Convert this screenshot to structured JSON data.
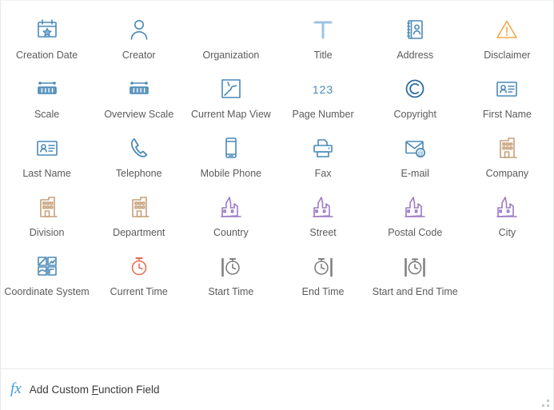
{
  "colors": {
    "icon_blue": "#4a89b8",
    "icon_blue_light": "#9dc3e0",
    "icon_orange": "#f0a848",
    "icon_tan": "#c6a079",
    "icon_purple": "#9b7bc4",
    "icon_red": "#e8705a",
    "icon_gray": "#808080",
    "caption": "#5b5b5b",
    "accent": "#3c9ce0",
    "panel_border": "#e6e8ea"
  },
  "gallery": {
    "columns": 6,
    "items": [
      {
        "label": "Creation Date",
        "icon": "calendar-star-icon",
        "color": "#4a89b8"
      },
      {
        "label": "Creator",
        "icon": "person-icon",
        "color": "#4a89b8"
      },
      {
        "label": "Organization",
        "icon": "none",
        "color": "#4a89b8"
      },
      {
        "label": "Title",
        "icon": "text-t-icon",
        "color": "#9dc3e0"
      },
      {
        "label": "Address",
        "icon": "address-book-icon",
        "color": "#4a89b8"
      },
      {
        "label": "Disclaimer",
        "icon": "warning-triangle-icon",
        "color": "#f0a848"
      },
      {
        "label": "Scale",
        "icon": "scale-bar-icon",
        "color": "#4a89b8"
      },
      {
        "label": "Overview Scale",
        "icon": "scale-bar-icon",
        "color": "#4a89b8"
      },
      {
        "label": "Current Map View",
        "icon": "map-frame-icon",
        "color": "#4a89b8"
      },
      {
        "label": "Page Number",
        "icon": "digits-123-icon",
        "color": "#4a89b8"
      },
      {
        "label": "Copyright",
        "icon": "copyright-icon",
        "color": "#2d6ca3"
      },
      {
        "label": "First Name",
        "icon": "contact-card-icon",
        "color": "#4a89b8"
      },
      {
        "label": "Last Name",
        "icon": "contact-card-icon",
        "color": "#4a89b8"
      },
      {
        "label": "Telephone",
        "icon": "telephone-icon",
        "color": "#4a89b8"
      },
      {
        "label": "Mobile Phone",
        "icon": "mobile-phone-icon",
        "color": "#4a89b8"
      },
      {
        "label": "Fax",
        "icon": "fax-printer-icon",
        "color": "#4a89b8"
      },
      {
        "label": "E-mail",
        "icon": "envelope-at-icon",
        "color": "#4a89b8"
      },
      {
        "label": "Company",
        "icon": "office-building-icon",
        "color": "#c6a079"
      },
      {
        "label": "Division",
        "icon": "office-building-icon",
        "color": "#c6a079"
      },
      {
        "label": "Department",
        "icon": "office-building-icon",
        "color": "#c6a079"
      },
      {
        "label": "Country",
        "icon": "cityscape-icon",
        "color": "#9b7bc4"
      },
      {
        "label": "Street",
        "icon": "cityscape-icon",
        "color": "#9b7bc4"
      },
      {
        "label": "Postal Code",
        "icon": "cityscape-icon",
        "color": "#9b7bc4"
      },
      {
        "label": "City",
        "icon": "cityscape-icon",
        "color": "#9b7bc4"
      },
      {
        "label": "Coordinate System",
        "icon": "map-tiles-grid-icon",
        "color": "#4a89b8"
      },
      {
        "label": "Current Time",
        "icon": "stopwatch-icon",
        "color": "#e8705a"
      },
      {
        "label": "Start Time",
        "icon": "stopwatch-start-icon",
        "color": "#808080"
      },
      {
        "label": "End Time",
        "icon": "stopwatch-end-icon",
        "color": "#808080"
      },
      {
        "label": "Start and End Time",
        "icon": "stopwatch-start-end-icon",
        "color": "#808080"
      }
    ]
  },
  "footer": {
    "icon": "fx-icon",
    "icon_text": "fx",
    "action_before": "Add Custom ",
    "action_accel": "F",
    "action_after": "unction Field",
    "resize_grip": "resize-grip-icon"
  }
}
